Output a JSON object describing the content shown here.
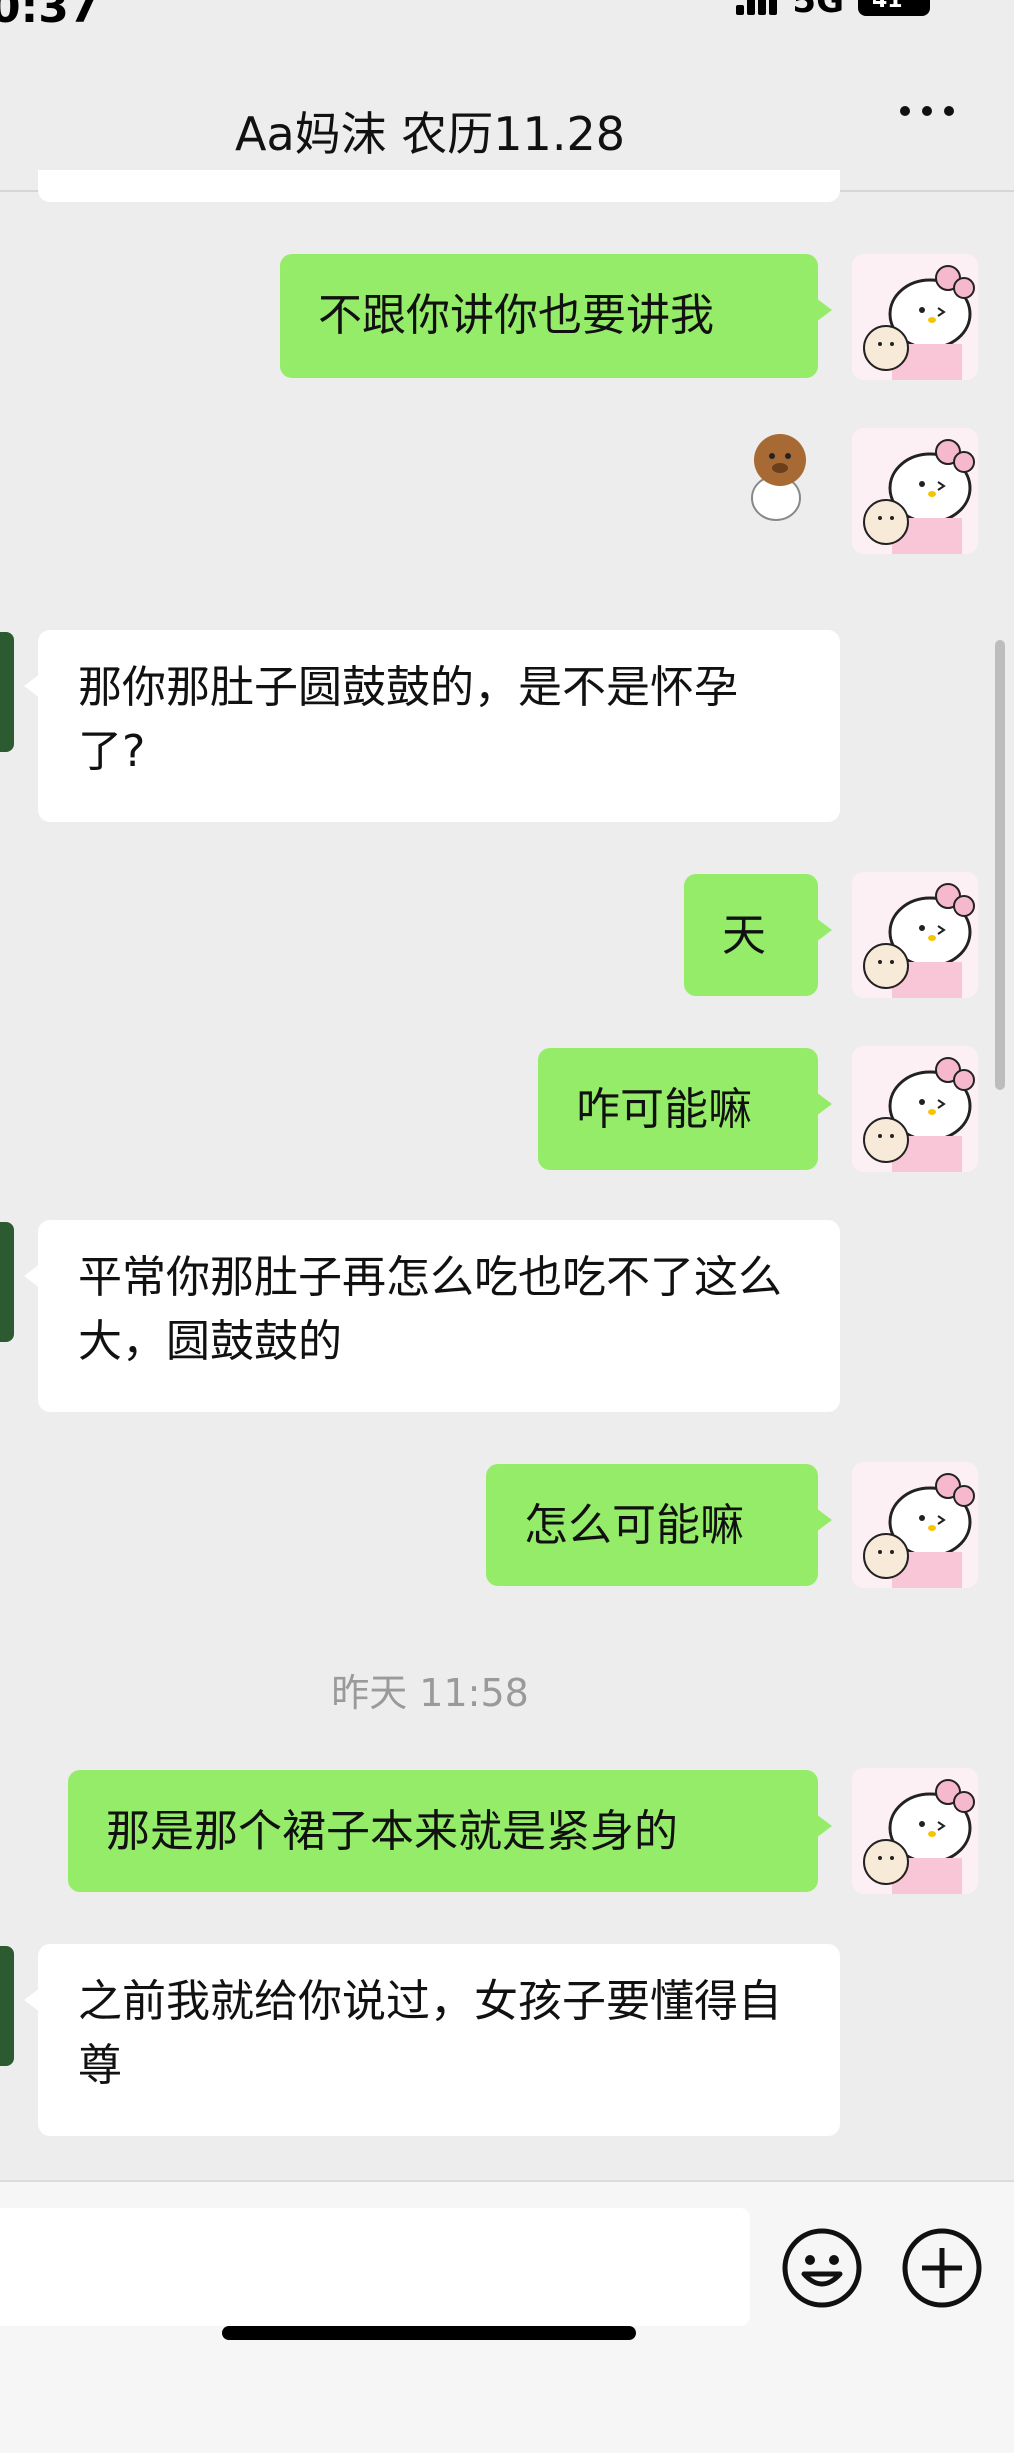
{
  "status_bar": {
    "time": "0:37",
    "network": "5G",
    "battery": "41"
  },
  "header": {
    "title": "Aa妈沫 农历11.28",
    "more_icon": "more-dots-icon"
  },
  "messages": [
    {
      "side": "out",
      "text": "不跟你讲你也要讲我"
    },
    {
      "side": "out",
      "type": "sticker",
      "icon": "hamster-sticker-icon"
    },
    {
      "side": "in",
      "text": "那你那肚子圆鼓鼓的，是不是怀孕了?"
    },
    {
      "side": "out",
      "text": "天"
    },
    {
      "side": "out",
      "text": "咋可能嘛"
    },
    {
      "side": "in",
      "text": "平常你那肚子再怎么吃也吃不了这么大，圆鼓鼓的"
    },
    {
      "side": "out",
      "text": "怎么可能嘛"
    },
    {
      "type": "timestamp",
      "text": "昨天 11:58"
    },
    {
      "side": "out",
      "text": "那是那个裙子本来就是紧身的"
    },
    {
      "side": "in",
      "text": "之前我就给你说过，女孩子要懂得自尊"
    }
  ],
  "input_bar": {
    "emoji_icon": "emoji-smile-icon",
    "plus_icon": "plus-circle-icon"
  },
  "colors": {
    "background": "#ededed",
    "outgoing_bubble": "#95ec69",
    "incoming_bubble": "#ffffff"
  }
}
